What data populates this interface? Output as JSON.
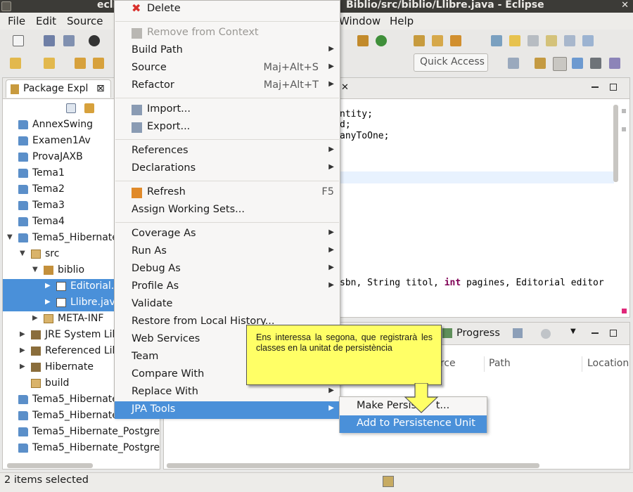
{
  "window": {
    "title_left": "ecli",
    "title_right": "Biblio/src/biblio/Llibre.java - Eclipse",
    "close": "✕"
  },
  "menubar": {
    "file": "File",
    "edit": "Edit",
    "source": "Source",
    "window": "Window",
    "help": "Help"
  },
  "toolbar": {
    "quick_access": "Quick Access"
  },
  "package_explorer": {
    "tab_label": "Package Expl",
    "tab_close": "⊠",
    "items": [
      {
        "label": "AnnexSwing",
        "indent": 0,
        "twisty": "",
        "icon": "project-folder-icon",
        "selected": false
      },
      {
        "label": "Examen1Av",
        "indent": 0,
        "twisty": "",
        "icon": "project-folder-icon",
        "selected": false
      },
      {
        "label": "ProvaJAXB",
        "indent": 0,
        "twisty": "",
        "icon": "project-folder-icon",
        "selected": false
      },
      {
        "label": "Tema1",
        "indent": 0,
        "twisty": "",
        "icon": "project-folder-icon",
        "selected": false
      },
      {
        "label": "Tema2",
        "indent": 0,
        "twisty": "",
        "icon": "project-folder-icon",
        "selected": false
      },
      {
        "label": "Tema3",
        "indent": 0,
        "twisty": "",
        "icon": "project-folder-icon",
        "selected": false
      },
      {
        "label": "Tema4",
        "indent": 0,
        "twisty": "",
        "icon": "project-folder-icon",
        "selected": false
      },
      {
        "label": "Tema5_Hibernate",
        "indent": 0,
        "twisty": "▼",
        "icon": "open-project-folder-icon",
        "selected": false
      },
      {
        "label": "src",
        "indent": 1,
        "twisty": "▼",
        "icon": "source-folder-icon",
        "selected": false
      },
      {
        "label": "biblio",
        "indent": 2,
        "twisty": "▼",
        "icon": "package-icon",
        "selected": false
      },
      {
        "label": "Editorial.",
        "indent": 3,
        "twisty": "▶",
        "icon": "java-file-icon",
        "selected": true
      },
      {
        "label": "Llibre.jav",
        "indent": 3,
        "twisty": "▶",
        "icon": "java-file-icon",
        "selected": true
      },
      {
        "label": "META-INF",
        "indent": 2,
        "twisty": "▶",
        "icon": "folder-icon",
        "selected": false
      },
      {
        "label": "JRE System Lib",
        "indent": 1,
        "twisty": "▶",
        "icon": "library-icon",
        "selected": false
      },
      {
        "label": "Referenced Lib",
        "indent": 1,
        "twisty": "▶",
        "icon": "library-icon",
        "selected": false
      },
      {
        "label": "Hibernate",
        "indent": 1,
        "twisty": "▶",
        "icon": "library-icon",
        "selected": false
      },
      {
        "label": "build",
        "indent": 1,
        "twisty": "",
        "icon": "folder-icon",
        "selected": false
      },
      {
        "label": "Tema5_Hibernate",
        "indent": 0,
        "twisty": "",
        "icon": "project-folder-icon",
        "selected": false
      },
      {
        "label": "Tema5_Hibernate",
        "indent": 0,
        "twisty": "",
        "icon": "project-folder-icon",
        "selected": false
      },
      {
        "label": "Tema5_Hibernate_Postgre",
        "indent": 0,
        "twisty": "",
        "icon": "project-folder-icon",
        "selected": false
      },
      {
        "label": "Tema5_Hibernate_Postgre",
        "indent": 0,
        "twisty": "",
        "icon": "project-folder-icon",
        "selected": false
      }
    ]
  },
  "editor": {
    "tab_close": "✕",
    "lines": {
      "l1": "ntity;",
      "l2": "d;",
      "l3": "anyToOne;",
      "sig_a": "sbn, String titol, ",
      "sig_kw": "int",
      "sig_b": " pagines, Editorial editor"
    }
  },
  "bottom_panel": {
    "tab_progress": "Progress",
    "col_source": "urce",
    "col_path": "Path",
    "col_location": "Location"
  },
  "context_menu": {
    "items": [
      {
        "label": "Delete",
        "icon": "delete-icon",
        "accel": "",
        "arrow": false,
        "disabled": false,
        "sep_after": true
      },
      {
        "label": "Remove from Context",
        "icon": "remove-context-icon",
        "accel": "",
        "arrow": false,
        "disabled": true,
        "sep_after": false
      },
      {
        "label": "Build Path",
        "icon": "",
        "accel": "",
        "arrow": true,
        "disabled": false,
        "sep_after": false
      },
      {
        "label": "Source",
        "icon": "",
        "accel": "Maj+Alt+S",
        "arrow": true,
        "disabled": false,
        "sep_after": false
      },
      {
        "label": "Refactor",
        "icon": "",
        "accel": "Maj+Alt+T",
        "arrow": true,
        "disabled": false,
        "sep_after": true
      },
      {
        "label": "Import...",
        "icon": "import-icon",
        "accel": "",
        "arrow": false,
        "disabled": false,
        "sep_after": false
      },
      {
        "label": "Export...",
        "icon": "export-icon",
        "accel": "",
        "arrow": false,
        "disabled": false,
        "sep_after": true
      },
      {
        "label": "References",
        "icon": "",
        "accel": "",
        "arrow": true,
        "disabled": false,
        "sep_after": false
      },
      {
        "label": "Declarations",
        "icon": "",
        "accel": "",
        "arrow": true,
        "disabled": false,
        "sep_after": true
      },
      {
        "label": "Refresh",
        "icon": "refresh-icon",
        "accel": "F5",
        "arrow": false,
        "disabled": false,
        "sep_after": false
      },
      {
        "label": "Assign Working Sets...",
        "icon": "",
        "accel": "",
        "arrow": false,
        "disabled": false,
        "sep_after": true
      },
      {
        "label": "Coverage As",
        "icon": "",
        "accel": "",
        "arrow": true,
        "disabled": false,
        "sep_after": false
      },
      {
        "label": "Run As",
        "icon": "",
        "accel": "",
        "arrow": true,
        "disabled": false,
        "sep_after": false
      },
      {
        "label": "Debug As",
        "icon": "",
        "accel": "",
        "arrow": true,
        "disabled": false,
        "sep_after": false
      },
      {
        "label": "Profile As",
        "icon": "",
        "accel": "",
        "arrow": true,
        "disabled": false,
        "sep_after": false
      },
      {
        "label": "Validate",
        "icon": "",
        "accel": "",
        "arrow": false,
        "disabled": false,
        "sep_after": false
      },
      {
        "label": "Restore from Local History...",
        "icon": "",
        "accel": "",
        "arrow": false,
        "disabled": false,
        "sep_after": false
      },
      {
        "label": "Web Services",
        "icon": "",
        "accel": "",
        "arrow": true,
        "disabled": false,
        "sep_after": false
      },
      {
        "label": "Team",
        "icon": "",
        "accel": "",
        "arrow": true,
        "disabled": false,
        "sep_after": false
      },
      {
        "label": "Compare With",
        "icon": "",
        "accel": "",
        "arrow": true,
        "disabled": false,
        "sep_after": false
      },
      {
        "label": "Replace With",
        "icon": "",
        "accel": "",
        "arrow": true,
        "disabled": false,
        "sep_after": false
      },
      {
        "label": "JPA Tools",
        "icon": "",
        "accel": "",
        "arrow": true,
        "disabled": false,
        "sep_after": false,
        "highlighted": true
      }
    ]
  },
  "submenu": {
    "items": [
      {
        "label": "Make Persist",
        "suffix": "t...",
        "highlighted": false
      },
      {
        "label": "Add to Persistence Unit",
        "highlighted": true
      }
    ]
  },
  "callout": {
    "text": "Ens interessa la segona, que registrarà les classes en la unitat de persistència"
  },
  "status": {
    "text": "2 items selected"
  },
  "colors": {
    "selection": "#4a90d9",
    "callout": "#ffff66",
    "titlebar": "#3c3b37"
  }
}
